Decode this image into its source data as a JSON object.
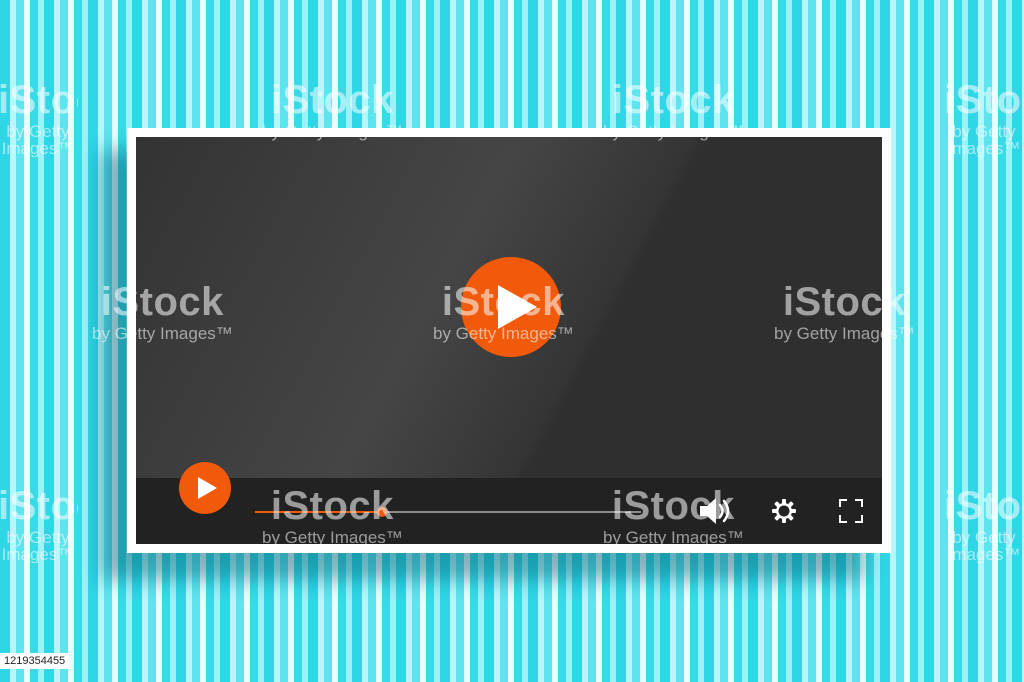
{
  "player": {
    "progress_fraction": 0.33,
    "accent_color": "#f05a0a",
    "background_color": "#333333",
    "icons": {
      "big_play": "play-icon",
      "small_play": "play-icon",
      "volume": "volume-icon",
      "settings": "gear-icon",
      "fullscreen": "fullscreen-icon"
    }
  },
  "watermark": {
    "brand": "iStock",
    "by_line": "by Getty Images™"
  },
  "stock_id": "1219354455"
}
